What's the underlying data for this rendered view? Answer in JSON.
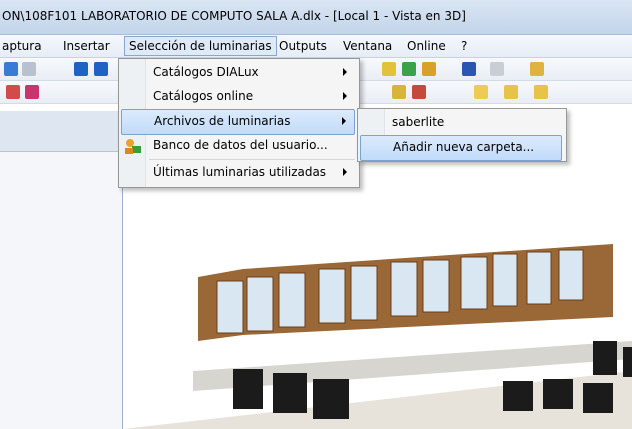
{
  "window": {
    "title": "ON\\108F101 LABORATORIO DE COMPUTO SALA A.dlx - [Local 1 - Vista en 3D]"
  },
  "menubar": {
    "items": [
      {
        "label": "aptura"
      },
      {
        "label": "Insertar"
      },
      {
        "label": "Selección de luminarias"
      },
      {
        "label": "Outputs"
      },
      {
        "label": "Ventana"
      },
      {
        "label": "Online"
      },
      {
        "label": "?"
      }
    ]
  },
  "menu": {
    "items": [
      {
        "label": "Catálogos DIALux",
        "has_submenu": true
      },
      {
        "label": "Catálogos online",
        "has_submenu": true
      },
      {
        "label": "Archivos de luminarias",
        "has_submenu": true,
        "highlighted": true
      },
      {
        "label": "Banco de datos del usuario...",
        "has_submenu": false,
        "icon": "user-database-icon"
      },
      {
        "label": "Últimas luminarias utilizadas",
        "has_submenu": true
      }
    ]
  },
  "submenu": {
    "items": [
      {
        "label": "saberlite"
      },
      {
        "label": "Añadir nueva carpeta...",
        "highlighted": true
      }
    ]
  },
  "colors": {
    "title_bar": "#c3d5ea",
    "menu_highlight": "#c1dbfa",
    "menu_border": "#979797",
    "window_frame": "#8c5a2b"
  }
}
